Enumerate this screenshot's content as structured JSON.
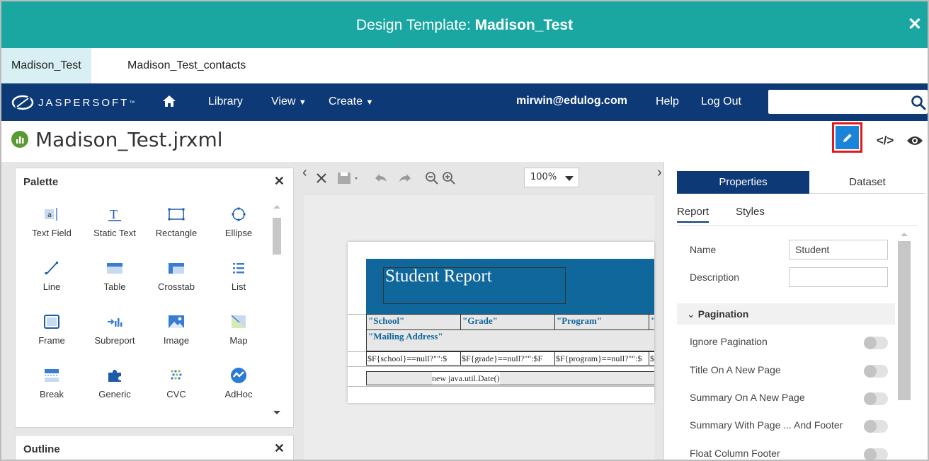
{
  "dialog": {
    "title_prefix": "Design Template: ",
    "title_name": "Madison_Test",
    "close_label": "✕"
  },
  "file_tabs": [
    {
      "label": "Madison_Test",
      "active": true
    },
    {
      "label": "Madison_Test_contacts",
      "active": false
    }
  ],
  "nav": {
    "logo_text": "JASPERSOFT",
    "trademark": "™",
    "library": "Library",
    "view": "View",
    "create": "Create",
    "user": "mirwin@edulog.com",
    "help": "Help",
    "logout": "Log Out",
    "search_value": ""
  },
  "report": {
    "file_name": "Madison_Test.jrxml"
  },
  "palette": {
    "title": "Palette",
    "close_label": "✕",
    "items": [
      {
        "label": "Text Field",
        "icon": "text-field-icon"
      },
      {
        "label": "Static Text",
        "icon": "static-text-icon"
      },
      {
        "label": "Rectangle",
        "icon": "rectangle-icon"
      },
      {
        "label": "Ellipse",
        "icon": "ellipse-icon"
      },
      {
        "label": "Line",
        "icon": "line-icon"
      },
      {
        "label": "Table",
        "icon": "table-icon"
      },
      {
        "label": "Crosstab",
        "icon": "crosstab-icon"
      },
      {
        "label": "List",
        "icon": "list-icon"
      },
      {
        "label": "Frame",
        "icon": "frame-icon"
      },
      {
        "label": "Subreport",
        "icon": "subreport-icon"
      },
      {
        "label": "Image",
        "icon": "image-icon"
      },
      {
        "label": "Map",
        "icon": "map-icon"
      },
      {
        "label": "Break",
        "icon": "break-icon"
      },
      {
        "label": "Generic",
        "icon": "generic-icon"
      },
      {
        "label": "CVC",
        "icon": "cvc-icon"
      },
      {
        "label": "AdHoc",
        "icon": "adhoc-icon"
      }
    ]
  },
  "outline": {
    "title": "Outline",
    "close_label": "✕"
  },
  "toolbar": {
    "zoom": "100%"
  },
  "canvas": {
    "report_title": "Student Report",
    "headers": [
      "\"School\"",
      "\"Grade\"",
      "\"Program\"",
      "\""
    ],
    "address_header": "\"Mailing Address\"",
    "details": [
      "$F{school}==null?\"\":$",
      "$F{grade}==null?\"\":$F",
      "$F{program}==null?\"\":$",
      "$"
    ],
    "footer": "new java.util.Date()"
  },
  "properties": {
    "tab_properties": "Properties",
    "tab_dataset": "Dataset",
    "subtab_report": "Report",
    "subtab_styles": "Styles",
    "name_label": "Name",
    "name_value": "Student",
    "description_label": "Description",
    "description_value": "",
    "pagination_label": "Pagination",
    "toggles": [
      "Ignore Pagination",
      "Title On A New Page",
      "Summary On A New Page",
      "Summary With Page ... And Footer",
      "Float Column Footer"
    ]
  },
  "colors": {
    "title_bar": "#1aa7a1",
    "nav_bar": "#0d3a76",
    "edit_button": "#1b84d9",
    "highlight": "#e01a1a",
    "report_band": "#0f679b"
  }
}
